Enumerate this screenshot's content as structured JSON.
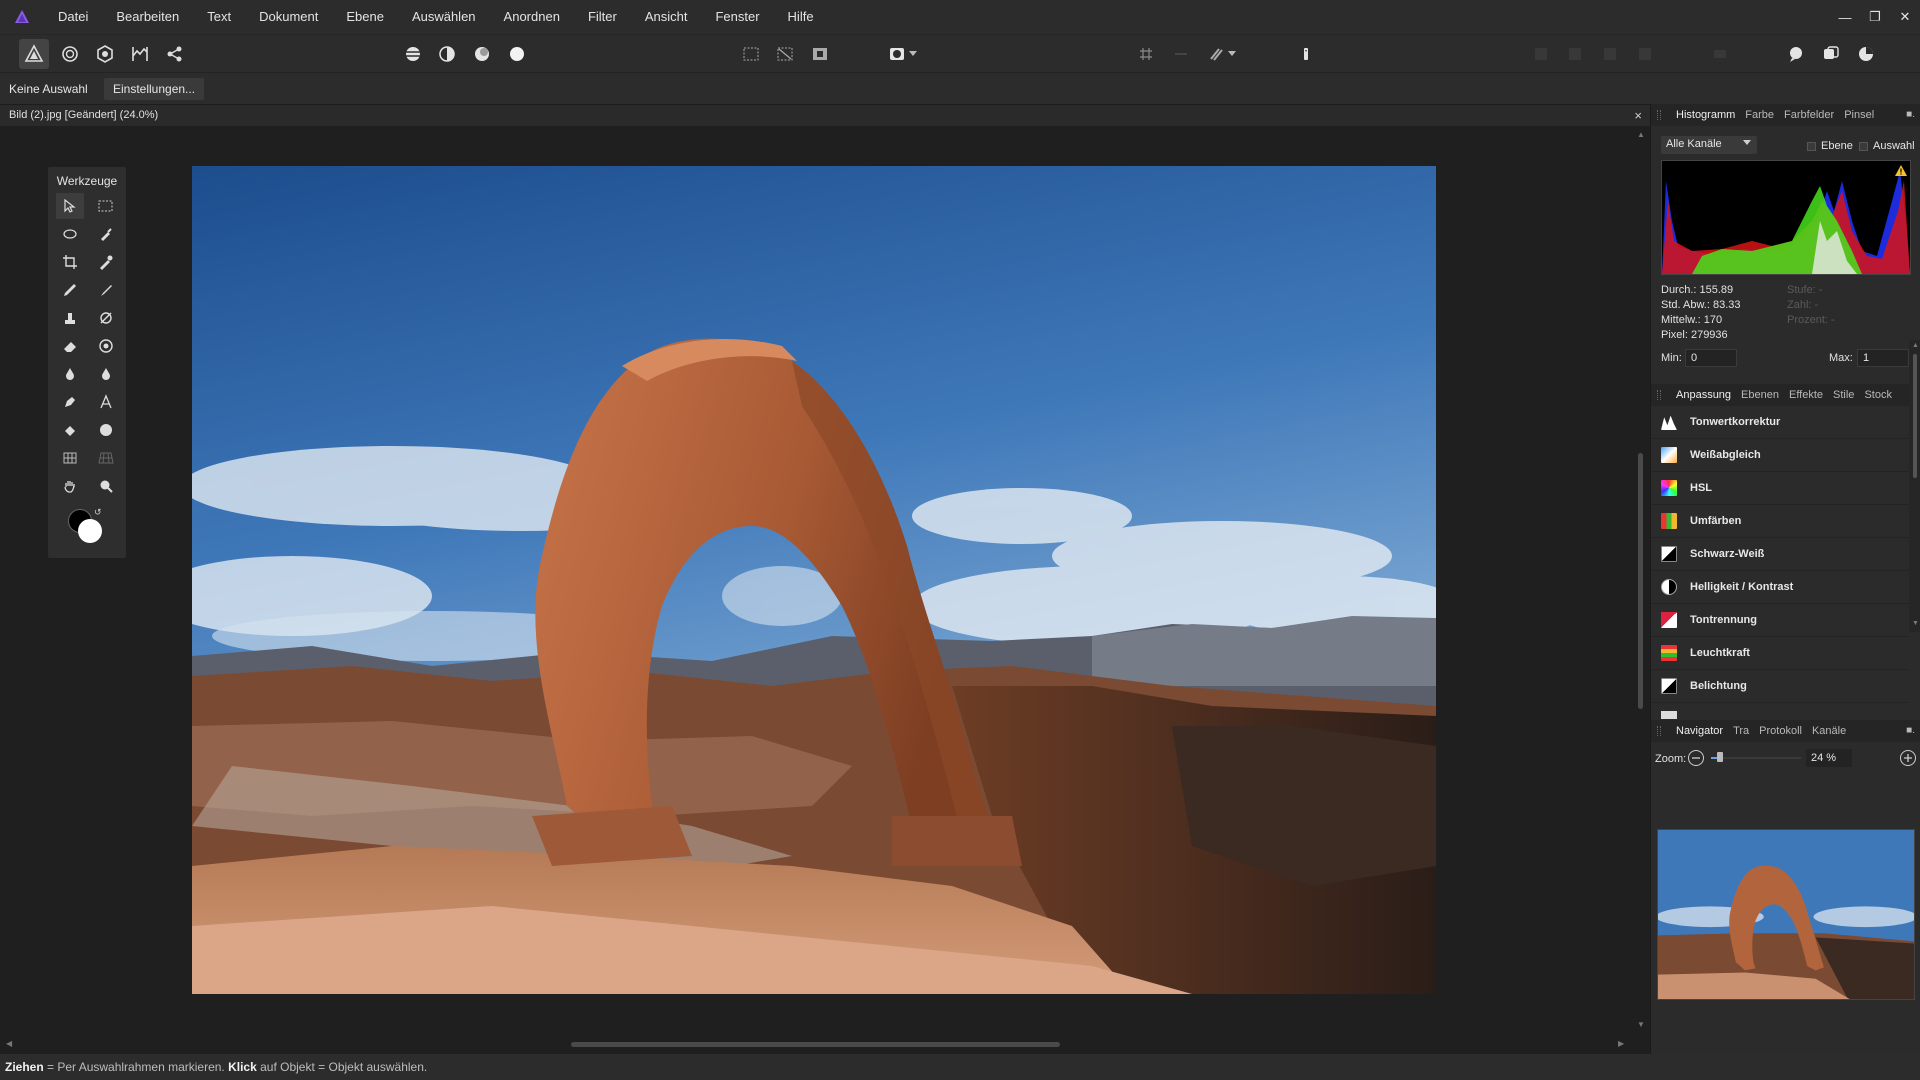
{
  "menubar": {
    "items": [
      "Datei",
      "Bearbeiten",
      "Text",
      "Dokument",
      "Ebene",
      "Auswählen",
      "Anordnen",
      "Filter",
      "Ansicht",
      "Fenster",
      "Hilfe"
    ],
    "window_controls": [
      "—",
      "❐",
      "✕"
    ]
  },
  "contextbar": {
    "selection_label": "Keine Auswahl",
    "settings_button": "Einstellungen..."
  },
  "document": {
    "tab_title": "Bild (2).jpg [Geändert] (24.0%)",
    "close_symbol": "×"
  },
  "tools_panel": {
    "title": "Werkzeuge"
  },
  "histogram_panel": {
    "tabs": [
      "Histogramm",
      "Farbe",
      "Farbfelder",
      "Pinsel"
    ],
    "channel_select": "Alle Kanäle",
    "checkbox_layer": "Ebene",
    "checkbox_selection": "Auswahl",
    "stats": {
      "mean": "Durch.: 155.89",
      "std_dev": "Std. Abw.: 83.33",
      "median": "Mittelw.: 170",
      "pixels": "Pixel: 279936",
      "level": "Stufe: -",
      "count": "Zahl: -",
      "percentile": "Prozent: -"
    },
    "min_label": "Min:",
    "min_value": "0",
    "max_label": "Max:",
    "max_value": "1"
  },
  "adjustment_panel": {
    "tabs": [
      "Anpassung",
      "Ebenen",
      "Effekte",
      "Stile",
      "Stock"
    ],
    "items": [
      {
        "label": "Tonwertkorrektur",
        "icon": "levels-icon"
      },
      {
        "label": "Weißabgleich",
        "icon": "white-balance-icon"
      },
      {
        "label": "HSL",
        "icon": "hsl-icon"
      },
      {
        "label": "Umfärben",
        "icon": "recolor-icon"
      },
      {
        "label": "Schwarz-Weiß",
        "icon": "black-white-icon"
      },
      {
        "label": "Helligkeit / Kontrast",
        "icon": "brightness-contrast-icon"
      },
      {
        "label": "Tontrennung",
        "icon": "posterize-icon"
      },
      {
        "label": "Leuchtkraft",
        "icon": "vibrance-icon"
      },
      {
        "label": "Belichtung",
        "icon": "exposure-icon"
      }
    ]
  },
  "navigator_panel": {
    "tabs": [
      "Navigator",
      "Tra",
      "Protokoll",
      "Kanäle"
    ],
    "zoom_label": "Zoom:",
    "zoom_value": "24 %",
    "zoom_level": 0.24
  },
  "statusbar": {
    "drag_bold": "Ziehen",
    "drag_text": " = Per Auswahlrahmen markieren. ",
    "click_bold": "Klick",
    "click_text": " auf Objekt = Objekt auswählen."
  },
  "colors": {
    "accent": "#7a4fd6",
    "panel_bg": "#2b2b2b",
    "canvas_bg": "#1f1f1f"
  }
}
